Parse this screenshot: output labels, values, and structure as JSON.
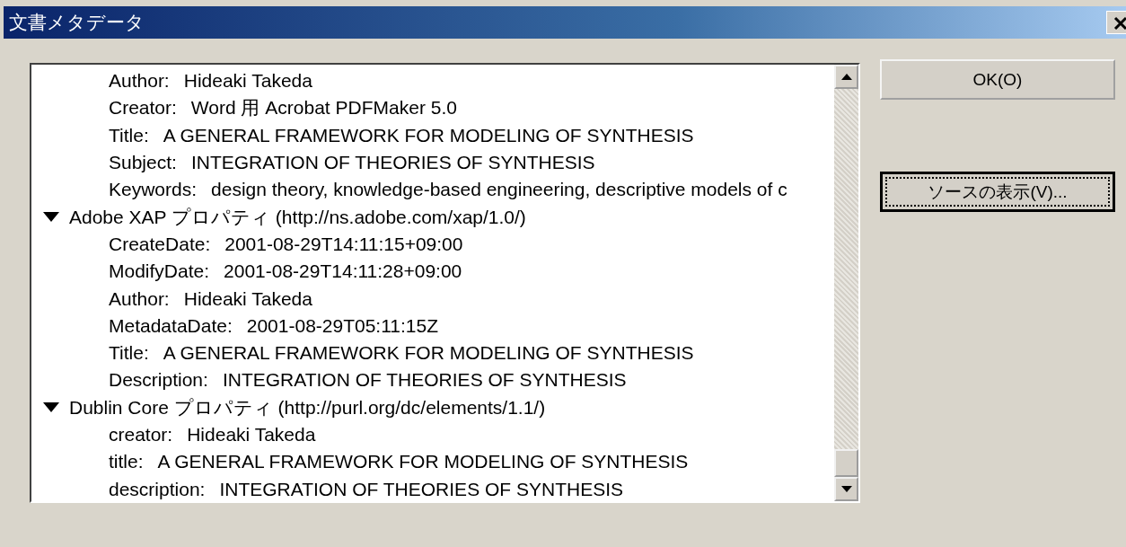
{
  "window": {
    "title": "文書メタデータ"
  },
  "properties": {
    "items": [
      {
        "kind": "entry",
        "key": "Author:",
        "value": "Hideaki Takeda"
      },
      {
        "kind": "entry",
        "key": "Creator:",
        "value": "Word 用 Acrobat PDFMaker 5.0"
      },
      {
        "kind": "entry",
        "key": "Title:",
        "value": "A GENERAL FRAMEWORK FOR MODELING OF SYNTHESIS"
      },
      {
        "kind": "entry",
        "key": "Subject:",
        "value": "INTEGRATION OF THEORIES OF SYNTHESIS"
      },
      {
        "kind": "entry",
        "key": "Keywords:",
        "value": "design theory, knowledge-based engineering, descriptive models of c"
      },
      {
        "kind": "group",
        "label": "Adobe XAP プロパティ (http://ns.adobe.com/xap/1.0/)",
        "expanded": true,
        "children": [
          {
            "kind": "entry",
            "key": "CreateDate:",
            "value": "2001-08-29T14:11:15+09:00"
          },
          {
            "kind": "entry",
            "key": "ModifyDate:",
            "value": "2001-08-29T14:11:28+09:00"
          },
          {
            "kind": "entry",
            "key": "Author:",
            "value": "Hideaki Takeda"
          },
          {
            "kind": "entry",
            "key": "MetadataDate:",
            "value": "2001-08-29T05:11:15Z"
          },
          {
            "kind": "entry",
            "key": "Title:",
            "value": "A GENERAL FRAMEWORK FOR MODELING OF SYNTHESIS"
          },
          {
            "kind": "entry",
            "key": "Description:",
            "value": "INTEGRATION OF THEORIES OF SYNTHESIS"
          }
        ]
      },
      {
        "kind": "group",
        "label": "Dublin Core プロパティ (http://purl.org/dc/elements/1.1/)",
        "expanded": true,
        "children": [
          {
            "kind": "entry",
            "key": "creator:",
            "value": "Hideaki Takeda"
          },
          {
            "kind": "entry",
            "key": "title:",
            "value": "A GENERAL FRAMEWORK FOR MODELING OF SYNTHESIS"
          },
          {
            "kind": "entry",
            "key": "description:",
            "value": "INTEGRATION OF THEORIES OF SYNTHESIS"
          }
        ]
      }
    ]
  },
  "buttons": [
    {
      "label": "OK(O)",
      "focused": false
    },
    {
      "label": "ソースの表示(V)...",
      "focused": true
    }
  ]
}
